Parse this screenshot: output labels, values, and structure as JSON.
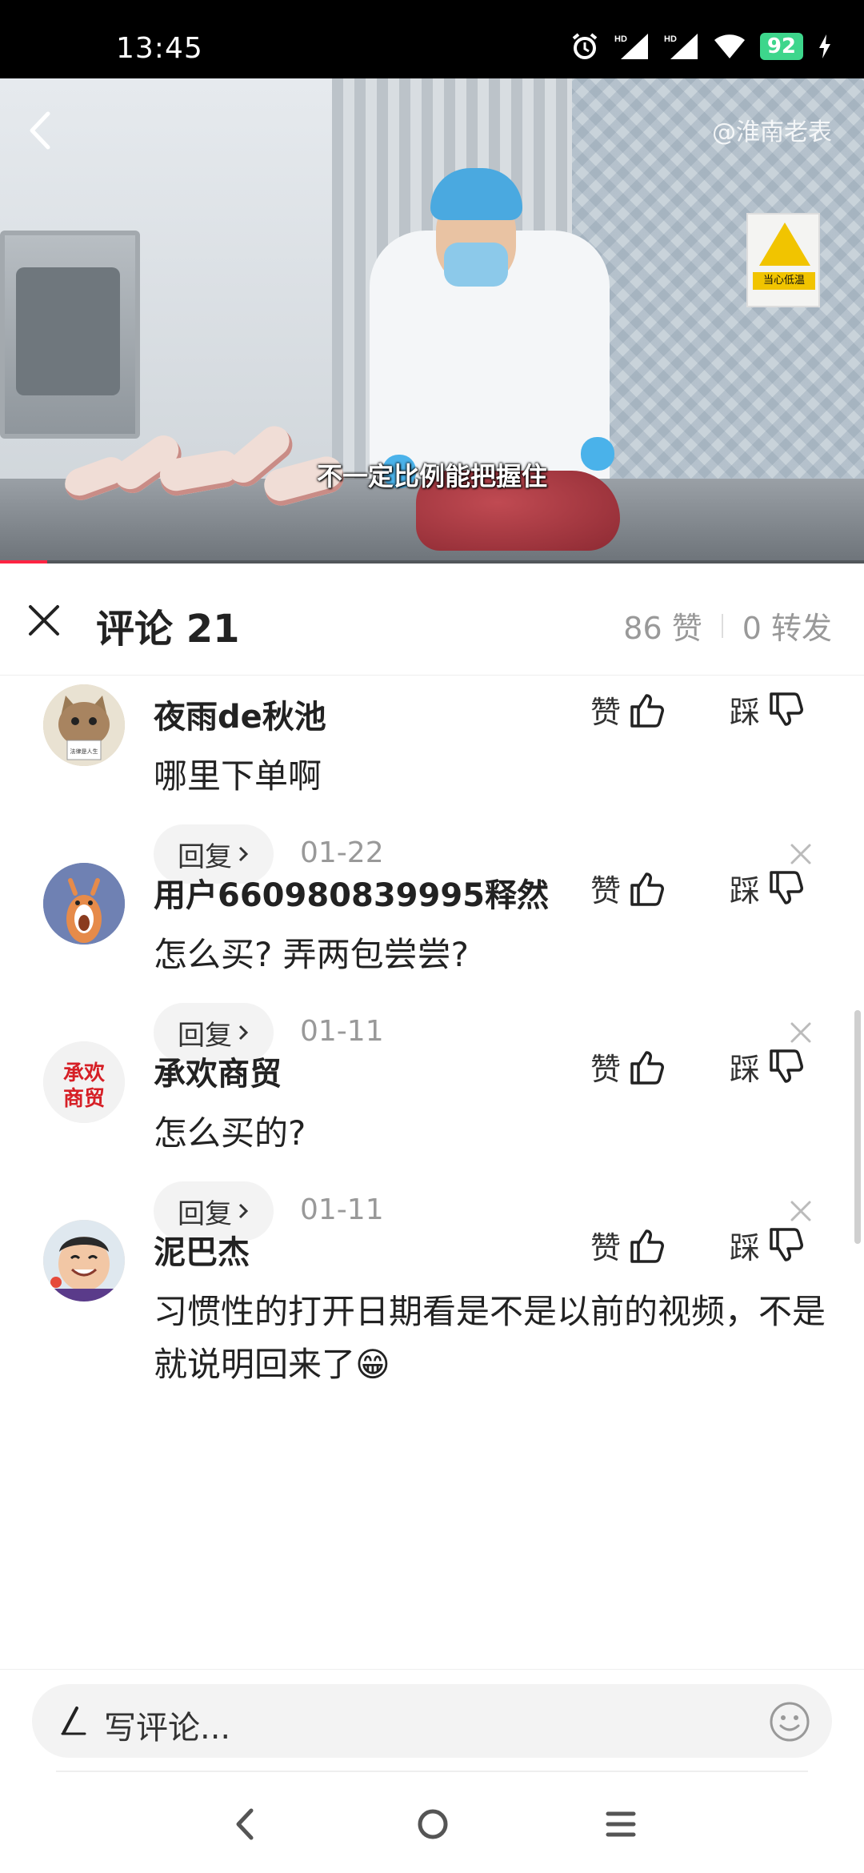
{
  "status_bar": {
    "time": "13:45",
    "battery": "92",
    "icons": [
      "alarm-icon",
      "hd-signal-icon",
      "hd-signal-icon",
      "wifi-icon",
      "battery-icon",
      "charging-icon"
    ]
  },
  "video": {
    "watermark": "@淮南老表",
    "subtitle": "不一定比例能把握住",
    "sign_text": "当心低温",
    "progress_percent": 5.5
  },
  "comments_header": {
    "title": "评论 21",
    "likes": "86 赞",
    "shares": "0 转发"
  },
  "comments": [
    {
      "name": "夜雨de秋池",
      "text": "哪里下单啊",
      "like_label": "赞",
      "dislike_label": "踩",
      "reply_label": "回复",
      "date": "01-22",
      "avatar": "cat-avatar",
      "avatar_sign": "法律是人生"
    },
    {
      "name": "用户660980839995释然",
      "text": "怎么买? 弄两包尝尝?",
      "like_label": "赞",
      "dislike_label": "踩",
      "reply_label": "回复",
      "date": "01-11",
      "avatar": "cartoon-avatar"
    },
    {
      "name": "承欢商贸",
      "text": "怎么买的?",
      "like_label": "赞",
      "dislike_label": "踩",
      "reply_label": "回复",
      "date": "01-11",
      "avatar": "text-avatar",
      "avatar_text_1": "承欢",
      "avatar_text_2": "商贸"
    },
    {
      "name": "泥巴杰",
      "text": "习惯性的打开日期看是不是以前的视频，不是就说明回来了😁",
      "like_label": "赞",
      "dislike_label": "踩",
      "avatar": "child-avatar"
    }
  ],
  "input": {
    "placeholder": "写评论..."
  },
  "colors": {
    "accent": "#ff2442",
    "muted": "#999999",
    "battery": "#3dd68c"
  }
}
